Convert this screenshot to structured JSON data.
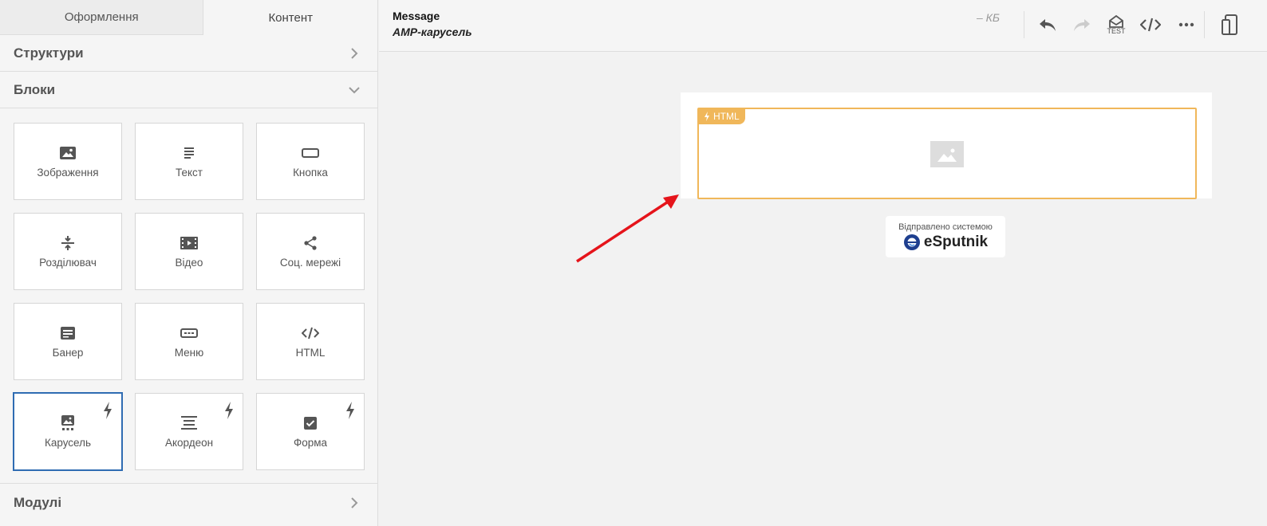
{
  "tabs": [
    {
      "label": "Оформлення"
    },
    {
      "label": "Контент"
    }
  ],
  "sections": {
    "structures": "Структури",
    "blocks": "Блоки",
    "modules": "Модулі"
  },
  "blocks": [
    {
      "label": "Зображення",
      "icon": "image-icon"
    },
    {
      "label": "Текст",
      "icon": "text-icon"
    },
    {
      "label": "Кнопка",
      "icon": "button-icon"
    },
    {
      "label": "Розділювач",
      "icon": "divider-icon"
    },
    {
      "label": "Відео",
      "icon": "video-icon"
    },
    {
      "label": "Соц. мережі",
      "icon": "share-icon"
    },
    {
      "label": "Банер",
      "icon": "banner-icon"
    },
    {
      "label": "Меню",
      "icon": "menu-icon"
    },
    {
      "label": "HTML",
      "icon": "code-icon"
    },
    {
      "label": "Карусель",
      "icon": "carousel-icon",
      "amp": true,
      "selected": true
    },
    {
      "label": "Акордеон",
      "icon": "accordion-icon",
      "amp": true
    },
    {
      "label": "Форма",
      "icon": "form-icon",
      "amp": true
    }
  ],
  "header": {
    "title": "Message",
    "subtitle": "AMP-карусель",
    "size": "– КБ",
    "test_label": "TEST"
  },
  "canvas": {
    "html_tag": "HTML",
    "badge_text": "Відправлено системою",
    "brand": "eSputnik"
  },
  "colors": {
    "accent_selected": "#2f6cb2",
    "amp_orange": "#f0b75a",
    "arrow_red": "#e5141b"
  }
}
